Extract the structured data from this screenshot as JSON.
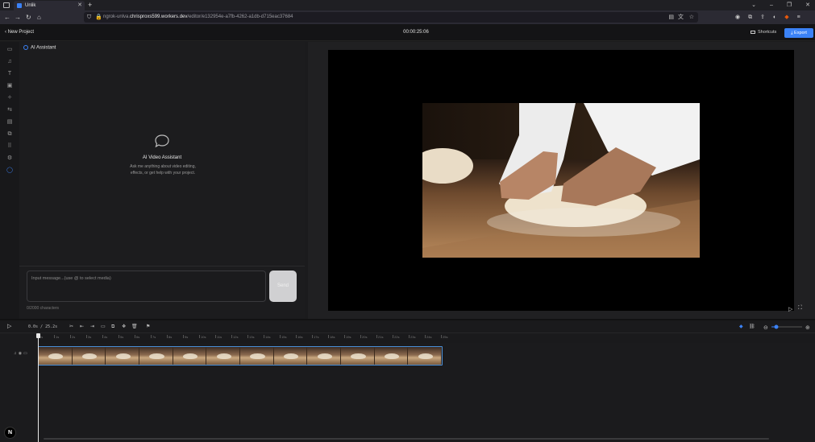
{
  "browser": {
    "tab_title": "Unlik",
    "new_tab": "+",
    "url_prefix": "ngrok-unlva.",
    "url_domain": "chrisproxs599.workers.dev",
    "url_path": "/editor/e132954e-a7fb-4262-a1db-d715eac37684"
  },
  "header": {
    "back_label": "‹  New Project",
    "timecode": "00:00:25:06",
    "shortcuts_label": "Shortcuts",
    "export_label": "⤓  Export"
  },
  "rail": {
    "icons": [
      "video-icon",
      "music-icon",
      "text-icon",
      "sticker-icon",
      "effects-icon",
      "transition-icon",
      "caption-icon",
      "layers-icon",
      "grid-icon",
      "settings-icon",
      "ai-chat-icon"
    ]
  },
  "ai_panel": {
    "title": "AI Assistant",
    "heading": "AI Video Assistant",
    "description": "Ask me anything about video editing, effects, or get help with your project.",
    "input_placeholder": "Input message...(use @ to select media)",
    "send_label": "Send",
    "char_count": "0/2000 characters"
  },
  "timeline": {
    "time_display": "0.0s / 25.2s",
    "ruler_ticks": [
      "0s",
      "1s",
      "2s",
      "3s",
      "4s",
      "5s",
      "6s",
      "7s",
      "8s",
      "9s",
      "10s",
      "11s",
      "12s",
      "13s",
      "14s",
      "15s",
      "16s",
      "17s",
      "18s",
      "19s",
      "20s",
      "21s",
      "22s",
      "23s",
      "24s",
      "25s"
    ],
    "clip_frames": 12,
    "playhead_position_s": 0.0
  },
  "colors": {
    "accent": "#3b82f6",
    "background": "#1b1b1d"
  },
  "badge_letter": "N"
}
